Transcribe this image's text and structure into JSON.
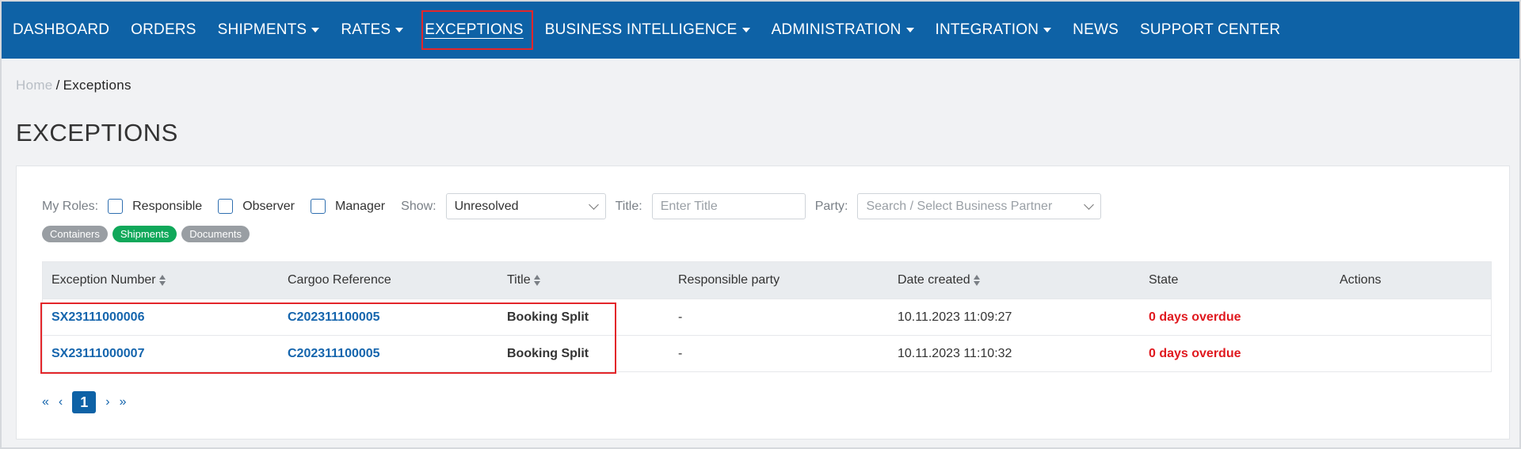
{
  "nav": {
    "items": [
      {
        "label": "DASHBOARD",
        "dropdown": false
      },
      {
        "label": "ORDERS",
        "dropdown": false
      },
      {
        "label": "SHIPMENTS",
        "dropdown": true
      },
      {
        "label": "RATES",
        "dropdown": true
      },
      {
        "label": "EXCEPTIONS",
        "dropdown": false,
        "active": true
      },
      {
        "label": "BUSINESS INTELLIGENCE",
        "dropdown": true
      },
      {
        "label": "ADMINISTRATION",
        "dropdown": true
      },
      {
        "label": "INTEGRATION",
        "dropdown": true
      },
      {
        "label": "NEWS",
        "dropdown": false
      },
      {
        "label": "SUPPORT CENTER",
        "dropdown": false
      }
    ],
    "background": "#0e62a6"
  },
  "breadcrumb": {
    "home": "Home",
    "separator": "/",
    "current": "Exceptions"
  },
  "page_title": "EXCEPTIONS",
  "filters": {
    "roles_label": "My Roles:",
    "roles": [
      "Responsible",
      "Observer",
      "Manager"
    ],
    "show_label": "Show:",
    "show_value": "Unresolved",
    "title_label": "Title:",
    "title_placeholder": "Enter Title",
    "party_label": "Party:",
    "party_placeholder": "Search / Select Business Partner"
  },
  "tags": [
    {
      "label": "Containers",
      "active": false
    },
    {
      "label": "Shipments",
      "active": true
    },
    {
      "label": "Documents",
      "active": false
    }
  ],
  "table": {
    "headers": [
      "Exception Number",
      "Cargoo Reference",
      "Title",
      "Responsible party",
      "Date created",
      "State",
      "Actions"
    ],
    "rows": [
      {
        "exception_number": "SX23111000006",
        "cargoo_reference": "C202311100005",
        "title": "Booking Split",
        "responsible_party": "-",
        "date_created": "10.11.2023 11:09:27",
        "state": "0 days overdue",
        "actions": ""
      },
      {
        "exception_number": "SX23111000007",
        "cargoo_reference": "C202311100005",
        "title": "Booking Split",
        "responsible_party": "-",
        "date_created": "10.11.2023 11:10:32",
        "state": "0 days overdue",
        "actions": ""
      }
    ]
  },
  "pagination": {
    "first": "«",
    "prev": "‹",
    "current": "1",
    "next": "›",
    "last": "»"
  },
  "colors": {
    "accent": "#0e62a6",
    "link": "#1565ad",
    "overdue": "#e0191f",
    "active_tag": "#10a85a",
    "highlight": "#e3262a"
  }
}
